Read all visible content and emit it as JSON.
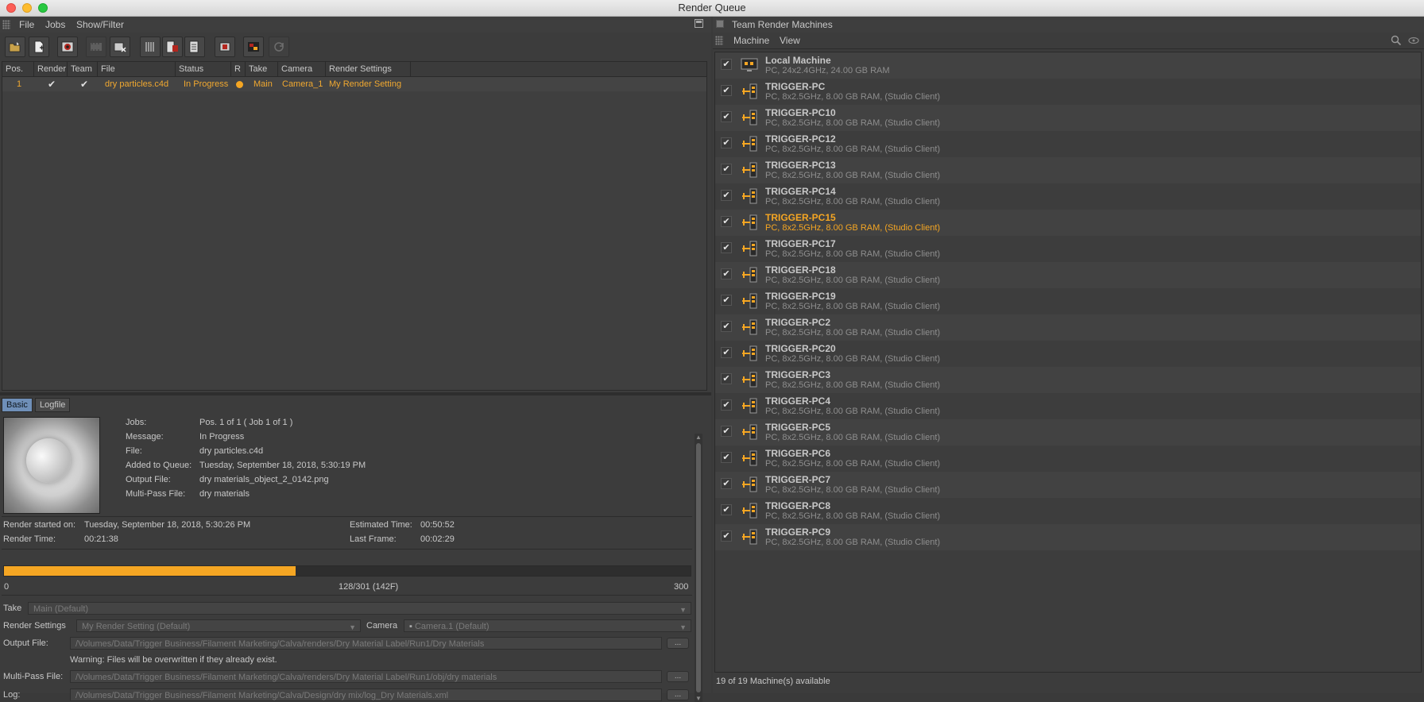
{
  "window": {
    "title": "Render Queue"
  },
  "menu": {
    "file": "File",
    "jobs": "Jobs",
    "show_filter": "Show/Filter"
  },
  "toolbar": [
    "open-icon",
    "new-doc-icon",
    "render-icon",
    "film-edit-icon",
    "film-delete-icon",
    "columns-icon",
    "clapper-list-icon",
    "doc-list-icon",
    "stop-icon",
    "render-team-icon",
    "refresh-icon"
  ],
  "job_table": {
    "columns": [
      "Pos.",
      "Render",
      "Team",
      "File",
      "Status",
      "R",
      "Take",
      "Camera",
      "Render Settings"
    ],
    "rows": [
      {
        "pos": "1",
        "render": "✔",
        "team": "✔",
        "file": "dry particles.c4d",
        "status": "In Progress",
        "take": "Main",
        "camera": "Camera_1",
        "render_settings": "My Render Setting"
      }
    ]
  },
  "tabs": {
    "basic": "Basic",
    "logfile": "Logfile"
  },
  "info": {
    "jobs_label": "Jobs:",
    "jobs_value": "Pos. 1 of 1 ( Job 1 of 1 )",
    "message_label": "Message:",
    "message_value": "In Progress",
    "file_label": "File:",
    "file_value": "dry particles.c4d",
    "added_label": "Added to Queue:",
    "added_value": "Tuesday, September 18, 2018, 5:30:19 PM",
    "output_label": "Output File:",
    "output_value": "dry materials_object_2_0142.png",
    "multipass_label": "Multi-Pass File:",
    "multipass_value": "dry materials"
  },
  "stats": {
    "started_label": "Render started on:",
    "started_value": "Tuesday, September 18, 2018, 5:30:26 PM",
    "render_time_label": "Render Time:",
    "render_time_value": "00:21:38",
    "estimated_label": "Estimated Time:",
    "estimated_value": "00:50:52",
    "last_frame_label": "Last Frame:",
    "last_frame_value": "00:02:29"
  },
  "progress": {
    "fraction": 0.4252,
    "min_label": "0",
    "mid_label": "128/301 (142F)",
    "max_label": "300"
  },
  "settings": {
    "take_label": "Take",
    "take_value": "Main (Default)",
    "render_settings_label": "Render Settings",
    "render_settings_value": "My Render Setting (Default)",
    "camera_label": "Camera",
    "camera_value": "Camera.1 (Default)",
    "output_label": "Output File:",
    "output_value": "/Volumes/Data/Trigger Business/Filament Marketing/Calva/renders/Dry Material Label/Run1/Dry Materials",
    "warning": "Warning: Files will be overwritten if they already exist.",
    "multipass_label": "Multi-Pass File:",
    "multipass_value": "/Volumes/Data/Trigger Business/Filament Marketing/Calva/renders/Dry Material Label/Run1/obj/dry materials",
    "log_label": "Log:",
    "log_value": "/Volumes/Data/Trigger Business/Filament Marketing/Calva/Design/dry mix/log_Dry Materials.xml",
    "browse": "..."
  },
  "team": {
    "title": "Team Render Machines",
    "menu_machine": "Machine",
    "menu_view": "View",
    "machines": [
      {
        "name": "Local Machine",
        "desc": "PC, 24x2.4GHz, 24.00 GB RAM",
        "local": true
      },
      {
        "name": "TRIGGER-PC",
        "desc": "PC, 8x2.5GHz, 8.00 GB RAM, (Studio Client)"
      },
      {
        "name": "TRIGGER-PC10",
        "desc": "PC, 8x2.5GHz, 8.00 GB RAM, (Studio Client)"
      },
      {
        "name": "TRIGGER-PC12",
        "desc": "PC, 8x2.5GHz, 8.00 GB RAM, (Studio Client)"
      },
      {
        "name": "TRIGGER-PC13",
        "desc": "PC, 8x2.5GHz, 8.00 GB RAM, (Studio Client)"
      },
      {
        "name": "TRIGGER-PC14",
        "desc": "PC, 8x2.5GHz, 8.00 GB RAM, (Studio Client)"
      },
      {
        "name": "TRIGGER-PC15",
        "desc": "PC, 8x2.5GHz, 8.00 GB RAM, (Studio Client)",
        "selected": true
      },
      {
        "name": "TRIGGER-PC17",
        "desc": "PC, 8x2.5GHz, 8.00 GB RAM, (Studio Client)"
      },
      {
        "name": "TRIGGER-PC18",
        "desc": "PC, 8x2.5GHz, 8.00 GB RAM, (Studio Client)"
      },
      {
        "name": "TRIGGER-PC19",
        "desc": "PC, 8x2.5GHz, 8.00 GB RAM, (Studio Client)"
      },
      {
        "name": "TRIGGER-PC2",
        "desc": "PC, 8x2.5GHz, 8.00 GB RAM, (Studio Client)"
      },
      {
        "name": "TRIGGER-PC20",
        "desc": "PC, 8x2.5GHz, 8.00 GB RAM, (Studio Client)"
      },
      {
        "name": "TRIGGER-PC3",
        "desc": "PC, 8x2.5GHz, 8.00 GB RAM, (Studio Client)"
      },
      {
        "name": "TRIGGER-PC4",
        "desc": "PC, 8x2.5GHz, 8.00 GB RAM, (Studio Client)"
      },
      {
        "name": "TRIGGER-PC5",
        "desc": "PC, 8x2.5GHz, 8.00 GB RAM, (Studio Client)"
      },
      {
        "name": "TRIGGER-PC6",
        "desc": "PC, 8x2.5GHz, 8.00 GB RAM, (Studio Client)"
      },
      {
        "name": "TRIGGER-PC7",
        "desc": "PC, 8x2.5GHz, 8.00 GB RAM, (Studio Client)"
      },
      {
        "name": "TRIGGER-PC8",
        "desc": "PC, 8x2.5GHz, 8.00 GB RAM, (Studio Client)"
      },
      {
        "name": "TRIGGER-PC9",
        "desc": "PC, 8x2.5GHz, 8.00 GB RAM, (Studio Client)"
      }
    ],
    "status": "19 of 19 Machine(s) available"
  },
  "colors": {
    "accent": "#f5a623",
    "panel": "#3c3c3c",
    "selected_tab": "#6f8fb8"
  }
}
